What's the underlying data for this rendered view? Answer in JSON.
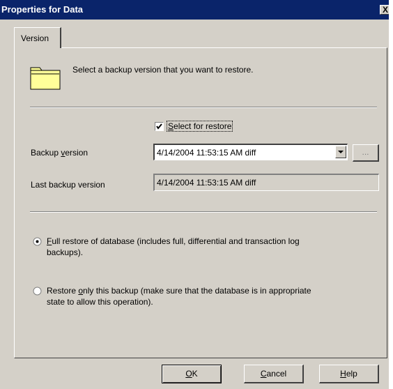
{
  "window": {
    "title": "Properties for Data",
    "close_glyph": "X"
  },
  "tabs": [
    {
      "label": "Version",
      "active": true
    }
  ],
  "instruction": {
    "icon": "folder-icon",
    "text": "Select a backup version that you want to restore."
  },
  "select_for_restore": {
    "label_first": "S",
    "label_rest": "elect for restore",
    "checked": true
  },
  "backup_version": {
    "label_pre": "Backup ",
    "label_accel": "v",
    "label_post": "ersion",
    "value": "4/14/2004 11:53:15 AM diff",
    "browse_label": "..."
  },
  "last_backup": {
    "label": "Last backup version",
    "value": "4/14/2004 11:53:15 AM diff"
  },
  "restore_options": [
    {
      "selected": true,
      "accel": "F",
      "line1_rest": "ull restore of database (includes full, differential and transaction log",
      "line2": "backups)."
    },
    {
      "selected": false,
      "pre": "Restore ",
      "accel": "o",
      "line1_rest": "nly this backup (make sure that the database is in appropriate",
      "line2": "state to allow this operation)."
    }
  ],
  "buttons": {
    "ok_accel": "O",
    "ok_rest": "K",
    "cancel_accel": "C",
    "cancel_rest": "ancel",
    "help_accel": "H",
    "help_rest": "elp"
  },
  "colors": {
    "titlebar": "#0a246a",
    "face": "#d4d0c8",
    "folder": "#ffff99"
  }
}
